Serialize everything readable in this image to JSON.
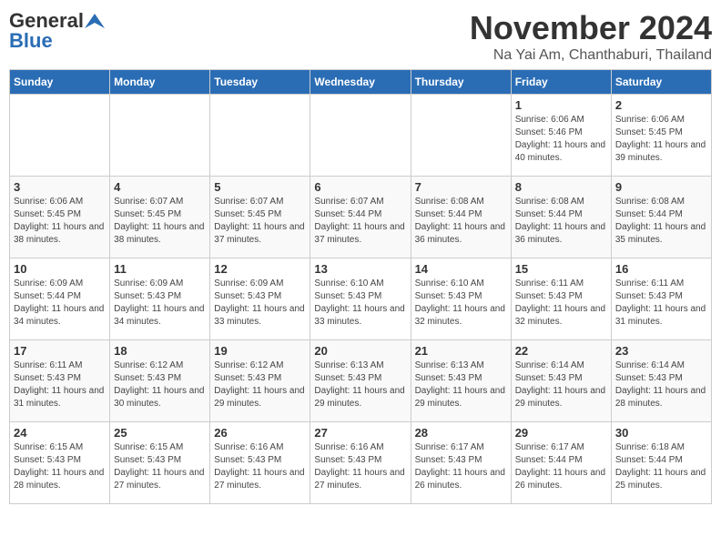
{
  "logo": {
    "general": "General",
    "blue": "Blue"
  },
  "header": {
    "title": "November 2024",
    "subtitle": "Na Yai Am, Chanthaburi, Thailand"
  },
  "weekdays": [
    "Sunday",
    "Monday",
    "Tuesday",
    "Wednesday",
    "Thursday",
    "Friday",
    "Saturday"
  ],
  "weeks": [
    [
      {
        "day": "",
        "info": ""
      },
      {
        "day": "",
        "info": ""
      },
      {
        "day": "",
        "info": ""
      },
      {
        "day": "",
        "info": ""
      },
      {
        "day": "",
        "info": ""
      },
      {
        "day": "1",
        "info": "Sunrise: 6:06 AM\nSunset: 5:46 PM\nDaylight: 11 hours and 40 minutes."
      },
      {
        "day": "2",
        "info": "Sunrise: 6:06 AM\nSunset: 5:45 PM\nDaylight: 11 hours and 39 minutes."
      }
    ],
    [
      {
        "day": "3",
        "info": "Sunrise: 6:06 AM\nSunset: 5:45 PM\nDaylight: 11 hours and 38 minutes."
      },
      {
        "day": "4",
        "info": "Sunrise: 6:07 AM\nSunset: 5:45 PM\nDaylight: 11 hours and 38 minutes."
      },
      {
        "day": "5",
        "info": "Sunrise: 6:07 AM\nSunset: 5:45 PM\nDaylight: 11 hours and 37 minutes."
      },
      {
        "day": "6",
        "info": "Sunrise: 6:07 AM\nSunset: 5:44 PM\nDaylight: 11 hours and 37 minutes."
      },
      {
        "day": "7",
        "info": "Sunrise: 6:08 AM\nSunset: 5:44 PM\nDaylight: 11 hours and 36 minutes."
      },
      {
        "day": "8",
        "info": "Sunrise: 6:08 AM\nSunset: 5:44 PM\nDaylight: 11 hours and 36 minutes."
      },
      {
        "day": "9",
        "info": "Sunrise: 6:08 AM\nSunset: 5:44 PM\nDaylight: 11 hours and 35 minutes."
      }
    ],
    [
      {
        "day": "10",
        "info": "Sunrise: 6:09 AM\nSunset: 5:44 PM\nDaylight: 11 hours and 34 minutes."
      },
      {
        "day": "11",
        "info": "Sunrise: 6:09 AM\nSunset: 5:43 PM\nDaylight: 11 hours and 34 minutes."
      },
      {
        "day": "12",
        "info": "Sunrise: 6:09 AM\nSunset: 5:43 PM\nDaylight: 11 hours and 33 minutes."
      },
      {
        "day": "13",
        "info": "Sunrise: 6:10 AM\nSunset: 5:43 PM\nDaylight: 11 hours and 33 minutes."
      },
      {
        "day": "14",
        "info": "Sunrise: 6:10 AM\nSunset: 5:43 PM\nDaylight: 11 hours and 32 minutes."
      },
      {
        "day": "15",
        "info": "Sunrise: 6:11 AM\nSunset: 5:43 PM\nDaylight: 11 hours and 32 minutes."
      },
      {
        "day": "16",
        "info": "Sunrise: 6:11 AM\nSunset: 5:43 PM\nDaylight: 11 hours and 31 minutes."
      }
    ],
    [
      {
        "day": "17",
        "info": "Sunrise: 6:11 AM\nSunset: 5:43 PM\nDaylight: 11 hours and 31 minutes."
      },
      {
        "day": "18",
        "info": "Sunrise: 6:12 AM\nSunset: 5:43 PM\nDaylight: 11 hours and 30 minutes."
      },
      {
        "day": "19",
        "info": "Sunrise: 6:12 AM\nSunset: 5:43 PM\nDaylight: 11 hours and 29 minutes."
      },
      {
        "day": "20",
        "info": "Sunrise: 6:13 AM\nSunset: 5:43 PM\nDaylight: 11 hours and 29 minutes."
      },
      {
        "day": "21",
        "info": "Sunrise: 6:13 AM\nSunset: 5:43 PM\nDaylight: 11 hours and 29 minutes."
      },
      {
        "day": "22",
        "info": "Sunrise: 6:14 AM\nSunset: 5:43 PM\nDaylight: 11 hours and 29 minutes."
      },
      {
        "day": "23",
        "info": "Sunrise: 6:14 AM\nSunset: 5:43 PM\nDaylight: 11 hours and 28 minutes."
      }
    ],
    [
      {
        "day": "24",
        "info": "Sunrise: 6:15 AM\nSunset: 5:43 PM\nDaylight: 11 hours and 28 minutes."
      },
      {
        "day": "25",
        "info": "Sunrise: 6:15 AM\nSunset: 5:43 PM\nDaylight: 11 hours and 27 minutes."
      },
      {
        "day": "26",
        "info": "Sunrise: 6:16 AM\nSunset: 5:43 PM\nDaylight: 11 hours and 27 minutes."
      },
      {
        "day": "27",
        "info": "Sunrise: 6:16 AM\nSunset: 5:43 PM\nDaylight: 11 hours and 27 minutes."
      },
      {
        "day": "28",
        "info": "Sunrise: 6:17 AM\nSunset: 5:43 PM\nDaylight: 11 hours and 26 minutes."
      },
      {
        "day": "29",
        "info": "Sunrise: 6:17 AM\nSunset: 5:44 PM\nDaylight: 11 hours and 26 minutes."
      },
      {
        "day": "30",
        "info": "Sunrise: 6:18 AM\nSunset: 5:44 PM\nDaylight: 11 hours and 25 minutes."
      }
    ]
  ]
}
